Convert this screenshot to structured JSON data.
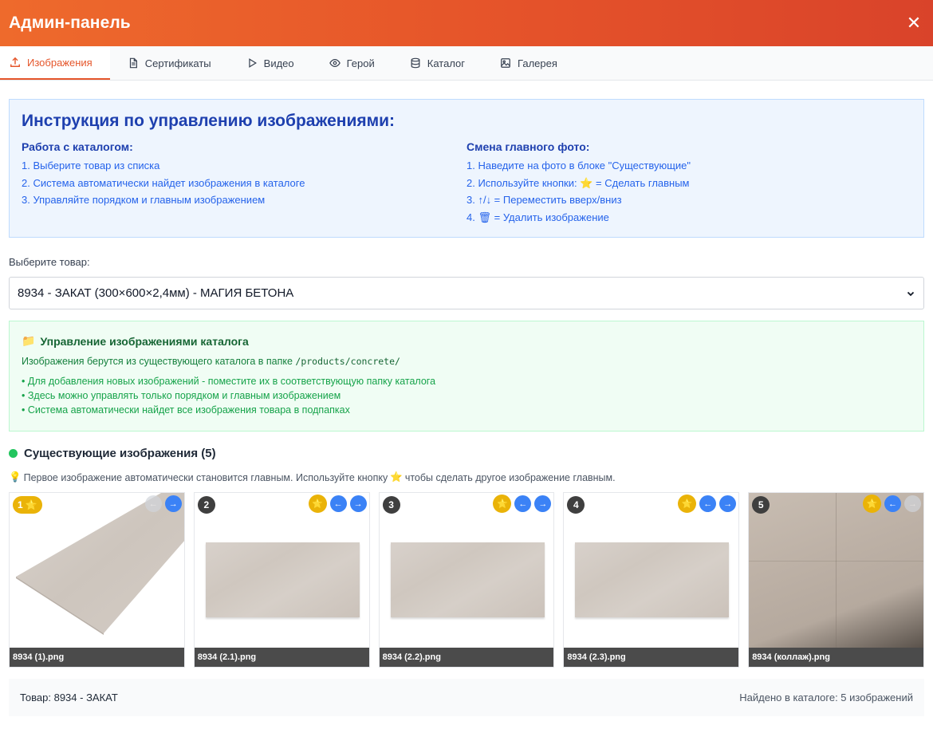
{
  "header": {
    "title": "Админ-панель",
    "close_icon": "close-icon"
  },
  "tabs": [
    {
      "label": "Изображения",
      "icon": "upload-icon",
      "active": true
    },
    {
      "label": "Сертификаты",
      "icon": "document-icon"
    },
    {
      "label": "Видео",
      "icon": "play-icon"
    },
    {
      "label": "Герой",
      "icon": "eye-icon"
    },
    {
      "label": "Каталог",
      "icon": "database-icon"
    },
    {
      "label": "Галерея",
      "icon": "image-icon"
    }
  ],
  "instructions": {
    "title": "Инструкция по управлению изображениями:",
    "left": {
      "heading": "Работа с каталогом:",
      "items": [
        "1. Выберите товар из списка",
        "2. Система автоматически найдет изображения в каталоге",
        "3. Управляйте порядком и главным изображением"
      ]
    },
    "right": {
      "heading": "Смена главного фото:",
      "item1": "1. Наведите на фото в блоке \"Существующие\"",
      "item2_prefix": "2. Используйте кнопки:",
      "item2_suffix": "= Сделать главным",
      "item3": "3. ↑/↓ = Переместить вверх/вниз",
      "item4_prefix": "4.",
      "item4_suffix": "= Удалить изображение"
    }
  },
  "product_select": {
    "label": "Выберите товар:",
    "value": "8934 - ЗАКАТ (300×600×2,4мм) - МАГИЯ БЕТОНА"
  },
  "catalog_management": {
    "title": "Управление изображениями каталога",
    "desc_prefix": "Изображения берутся из существующего каталога в папке",
    "path": "/products/concrete/",
    "bullets": [
      "• Для добавления новых изображений - поместите их в соответствующую папку каталога",
      "• Здесь можно управлять только порядком и главным изображением",
      "• Система автоматически найдет все изображения товара в подпапках"
    ]
  },
  "existing": {
    "title": "Существующие изображения (5)",
    "hint_prefix": "Первое изображение автоматически становится главным. Используйте кнопку",
    "hint_suffix": "чтобы сделать другое изображение главным.",
    "images": [
      {
        "num": "1",
        "name": "8934 (1).png"
      },
      {
        "num": "2",
        "name": "8934 (2.1).png"
      },
      {
        "num": "3",
        "name": "8934 (2.2).png"
      },
      {
        "num": "4",
        "name": "8934 (2.3).png"
      },
      {
        "num": "5",
        "name": "8934 (коллаж).png"
      }
    ]
  },
  "footer": {
    "product": "Товар: 8934 - ЗАКАТ",
    "found": "Найдено в каталоге: 5 изображений"
  },
  "colors": {
    "accent": "#e5562b",
    "blue": "#2563eb",
    "green": "#16a34a",
    "gold": "#eab308"
  }
}
